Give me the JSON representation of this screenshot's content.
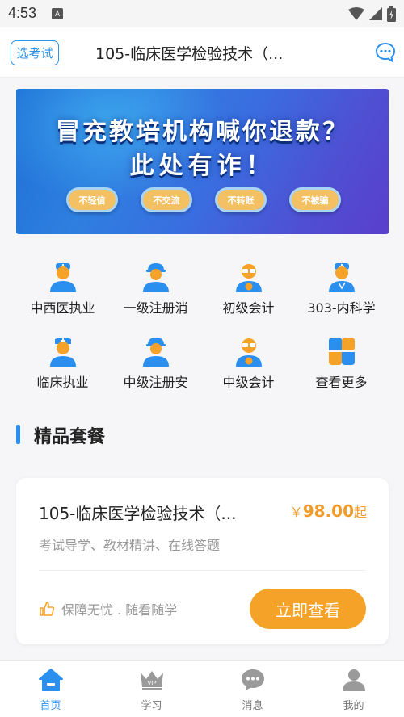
{
  "status_bar": {
    "time": "4:53",
    "notification_icon": "A"
  },
  "header": {
    "exam_button": "选考试",
    "title": "105-临床医学检验技术（...",
    "message_icon": "chat-bubble-icon"
  },
  "banner": {
    "line1": "冒充教培机构喊你退款？",
    "line2": "此处有诈！",
    "pills": [
      "不轻信",
      "不交流",
      "不转账",
      "不被骗"
    ]
  },
  "categories": [
    {
      "label": "中西医执业",
      "icon": "doctor-icon"
    },
    {
      "label": "一级注册消",
      "icon": "firefighter-icon"
    },
    {
      "label": "初级会计",
      "icon": "accountant-icon"
    },
    {
      "label": "303-内科学",
      "icon": "doctor-icon"
    },
    {
      "label": "临床执业",
      "icon": "nurse-icon"
    },
    {
      "label": "中级注册安",
      "icon": "engineer-icon"
    },
    {
      "label": "中级会计",
      "icon": "accountant-icon"
    },
    {
      "label": "查看更多",
      "icon": "more-grid-icon"
    }
  ],
  "section": {
    "title": "精品套餐"
  },
  "package": {
    "title": "105-临床医学检验技术（...",
    "price_currency": "￥",
    "price": "98.00",
    "price_suffix": "起",
    "description": "考试导学、教材精讲、在线答题",
    "guarantee": "保障无忧 . 随看随学",
    "view_button": "立即查看"
  },
  "bottom_nav": [
    {
      "label": "首页",
      "icon": "home-icon",
      "active": true
    },
    {
      "label": "学习",
      "icon": "vip-crown-icon",
      "active": false
    },
    {
      "label": "消息",
      "icon": "message-icon",
      "active": false
    },
    {
      "label": "我的",
      "icon": "user-icon",
      "active": false
    }
  ],
  "colors": {
    "accent_blue": "#2b8ff0",
    "accent_orange": "#f5a228",
    "price_orange": "#f19b2a"
  }
}
